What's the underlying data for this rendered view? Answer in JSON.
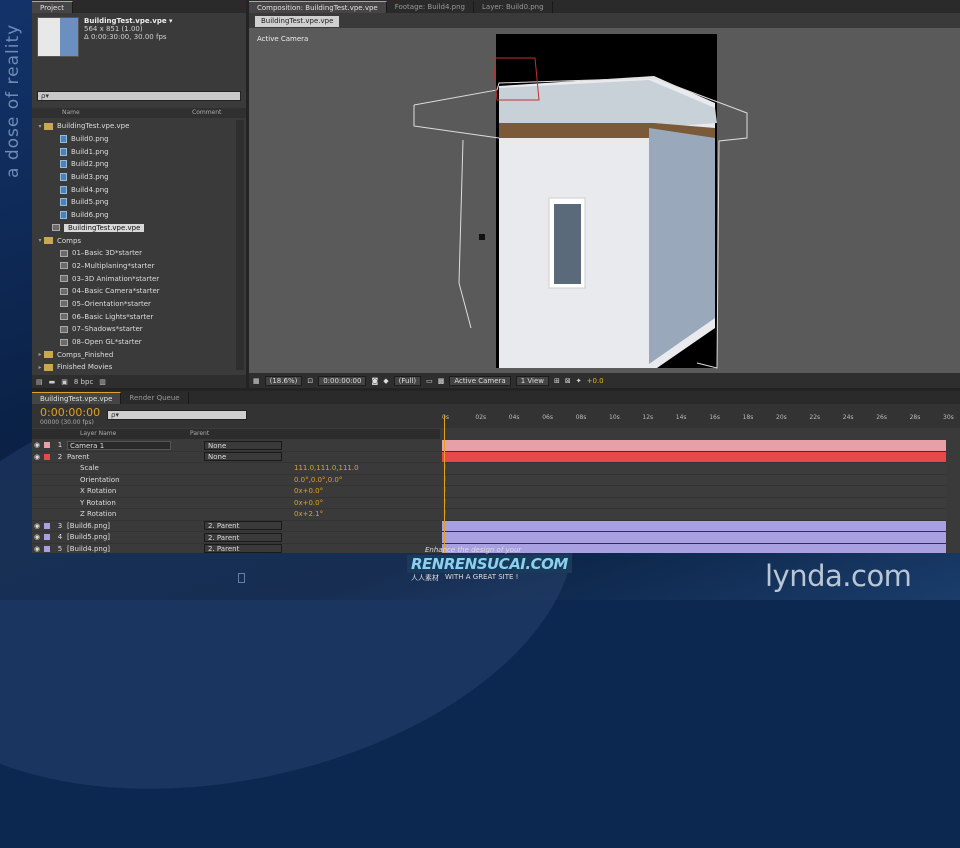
{
  "side_text": "a dose of reality",
  "project": {
    "tab": "Project",
    "file_title": "BuildingTest.vpe.vpe ▾",
    "file_dims": "564 x 851 (1.00)",
    "file_dur": "Δ 0:00:30:00, 30.00 fps",
    "search_placeholder": "ρ▾",
    "col_name": "Name",
    "col_comment": "Comment",
    "items": [
      {
        "label": "BuildingTest.vpe.vpe",
        "kind": "folder",
        "indent": 0,
        "open": true
      },
      {
        "label": "Build0.png",
        "kind": "file",
        "indent": 2
      },
      {
        "label": "Build1.png",
        "kind": "file",
        "indent": 2
      },
      {
        "label": "Build2.png",
        "kind": "file",
        "indent": 2
      },
      {
        "label": "Build3.png",
        "kind": "file",
        "indent": 2
      },
      {
        "label": "Build4.png",
        "kind": "file",
        "indent": 2
      },
      {
        "label": "Build5.png",
        "kind": "file",
        "indent": 2
      },
      {
        "label": "Build6.png",
        "kind": "file",
        "indent": 2
      },
      {
        "label": "BuildingTest.vpe.vpe",
        "kind": "comp",
        "indent": 1,
        "selected": true
      },
      {
        "label": "Comps",
        "kind": "folder",
        "indent": 0,
        "open": true
      },
      {
        "label": "01–Basic 3D*starter",
        "kind": "comp",
        "indent": 2
      },
      {
        "label": "02–Multiplaning*starter",
        "kind": "comp",
        "indent": 2
      },
      {
        "label": "03–3D Animation*starter",
        "kind": "comp",
        "indent": 2
      },
      {
        "label": "04–Basic Camera*starter",
        "kind": "comp",
        "indent": 2
      },
      {
        "label": "05–Orientation*starter",
        "kind": "comp",
        "indent": 2
      },
      {
        "label": "06–Basic Lights*starter",
        "kind": "comp",
        "indent": 2
      },
      {
        "label": "07–Shadows*starter",
        "kind": "comp",
        "indent": 2
      },
      {
        "label": "08–Open GL*starter",
        "kind": "comp",
        "indent": 2
      },
      {
        "label": "Comps_Finished",
        "kind": "folder",
        "indent": 0,
        "open": false
      },
      {
        "label": "Finished Movies",
        "kind": "folder",
        "indent": 0,
        "open": false
      }
    ],
    "bpc": "8 bpc"
  },
  "composition": {
    "tabs": [
      "Composition: BuildingTest.vpe.vpe",
      "Footage: Build4.png",
      "Layer: Build0.png"
    ],
    "view_tab": "BuildingTest.vpe.vpe",
    "active_camera": "Active Camera",
    "zoom": "(18.6%)",
    "timecode": "0:00:00:00",
    "resolution": "(Full)",
    "camera": "Active Camera",
    "views": "1 View",
    "exposure": "+0.0"
  },
  "timeline": {
    "tabs": [
      "BuildingTest.vpe.vpe",
      "Render Queue"
    ],
    "timecode": "0:00:00:00",
    "fps": "00000 (30.00 fps)",
    "search_placeholder": "ρ▾",
    "col_layer": "Layer Name",
    "col_parent": "Parent",
    "ticks": [
      "0s",
      "02s",
      "04s",
      "06s",
      "08s",
      "10s",
      "12s",
      "14s",
      "16s",
      "18s",
      "20s",
      "22s",
      "24s",
      "26s",
      "28s",
      "30s"
    ],
    "layers": [
      {
        "num": "1",
        "name": "Camera 1",
        "parent": "None",
        "color": "#e8a0a8",
        "boxed": true
      },
      {
        "num": "2",
        "name": "Parent",
        "parent": "None",
        "color": "#e84848"
      },
      {
        "num": "3",
        "name": "[Build6.png]",
        "parent": "2. Parent",
        "color": "#a8a0e0"
      },
      {
        "num": "4",
        "name": "[Build5.png]",
        "parent": "2. Parent",
        "color": "#a8a0e0"
      },
      {
        "num": "5",
        "name": "[Build4.png]",
        "parent": "2. Parent",
        "color": "#a8a0e0"
      }
    ],
    "props": [
      {
        "name": "Scale",
        "value": "111.0,111.0,111.0"
      },
      {
        "name": "Orientation",
        "value": "0.0°,0.0°,0.0°"
      },
      {
        "name": "X Rotation",
        "value": "0x+0.0°"
      },
      {
        "name": "Y Rotation",
        "value": "0x+0.0°"
      },
      {
        "name": "Z Rotation",
        "value": "0x+2.1°"
      }
    ]
  },
  "branding": {
    "lynda": "lynda.com",
    "badge_top": "Enhance the design of your",
    "badge_main": "RENRENSUCAI.COM",
    "badge_cn": "人人素材",
    "badge_bottom": "WITH A GREAT SITE !"
  },
  "colors": {
    "accent": "#e0a020",
    "ui_bg": "#3a3a3a",
    "desktop": "#0d2850"
  }
}
